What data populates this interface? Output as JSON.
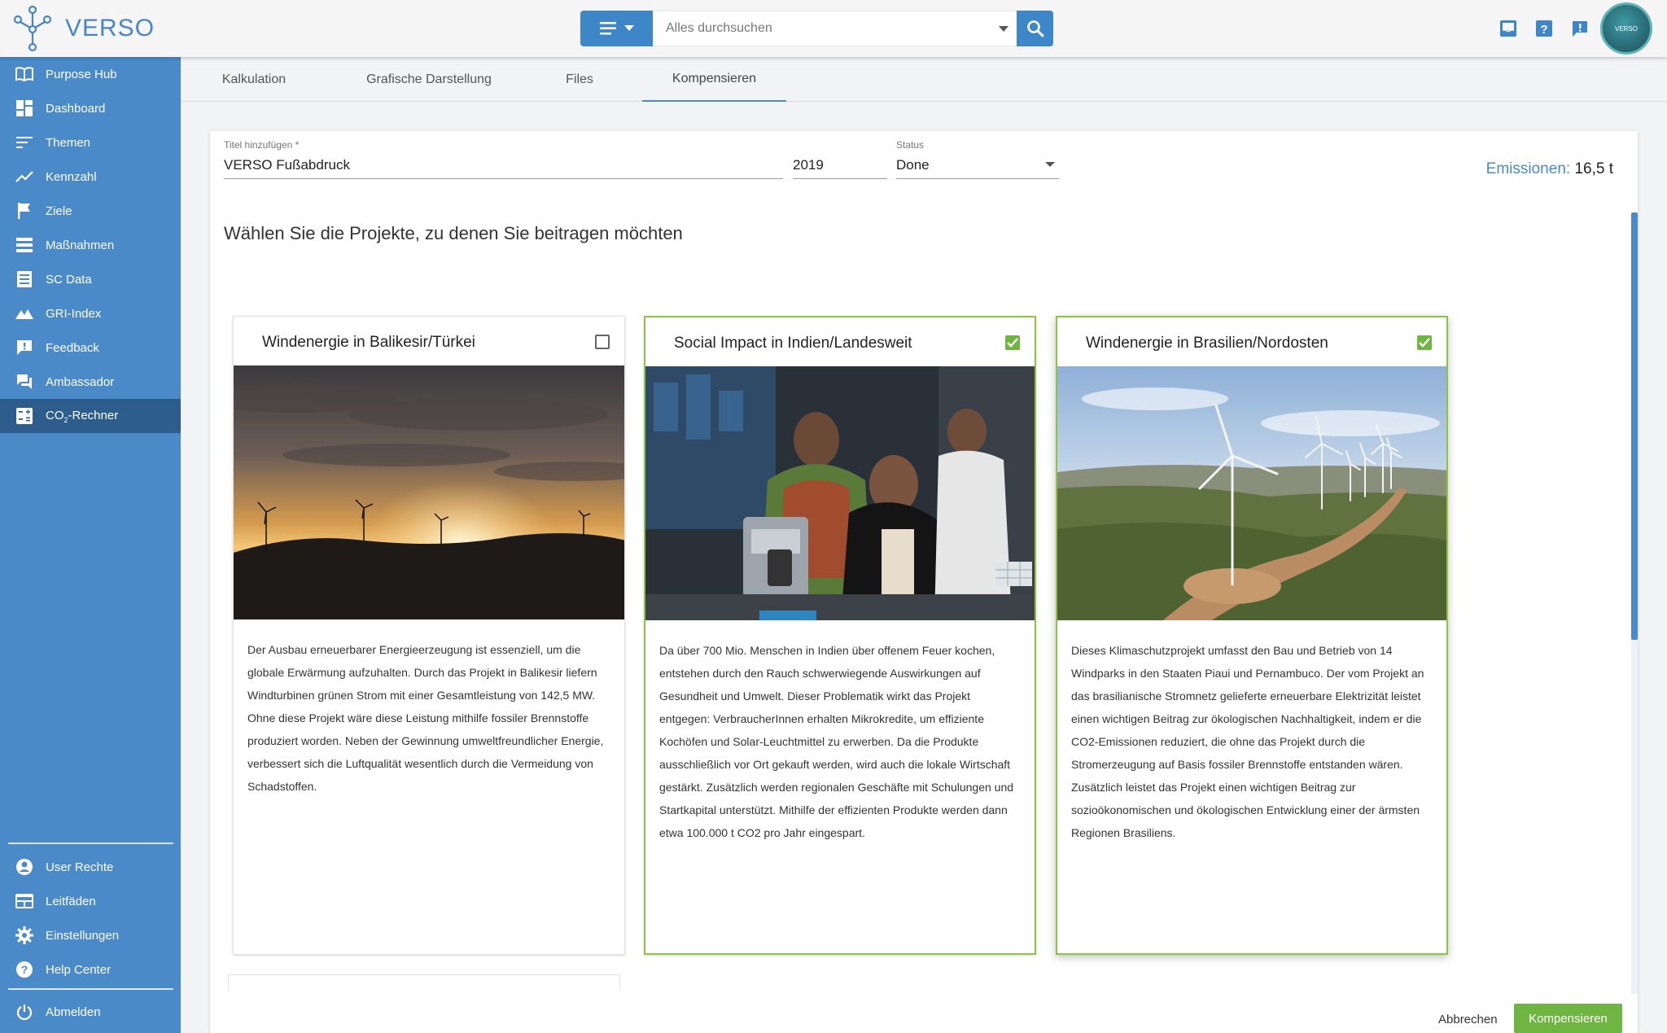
{
  "app": {
    "logo_text": "VERSO",
    "avatar_text": "VERSO"
  },
  "search": {
    "placeholder": "Alles durchsuchen"
  },
  "sidebar": {
    "items": [
      {
        "label": "Purpose Hub",
        "icon": "book-open-icon"
      },
      {
        "label": "Dashboard",
        "icon": "dashboard-icon"
      },
      {
        "label": "Themen",
        "icon": "lines-icon"
      },
      {
        "label": "Kennzahl",
        "icon": "trending-icon"
      },
      {
        "label": "Ziele",
        "icon": "flag-icon"
      },
      {
        "label": "Maßnahmen",
        "icon": "storage-icon"
      },
      {
        "label": "SC Data",
        "icon": "list-icon"
      },
      {
        "label": "GRI-Index",
        "icon": "terrain-icon"
      },
      {
        "label": "Feedback",
        "icon": "feedback-icon"
      },
      {
        "label": "Ambassador",
        "icon": "forum-icon"
      },
      {
        "label_main": "CO",
        "label_sub": "2",
        "label_rest": "-Rechner",
        "icon": "calculator-icon",
        "active": true
      }
    ],
    "bottom_items": [
      {
        "label": "User Rechte",
        "icon": "account-circle-icon"
      },
      {
        "label": "Leitfäden",
        "icon": "web-icon"
      },
      {
        "label": "Einstellungen",
        "icon": "gear-icon"
      },
      {
        "label": "Help Center",
        "icon": "help-circle-icon"
      },
      {
        "label": "Abmelden",
        "icon": "power-icon"
      }
    ]
  },
  "tabs": [
    {
      "label": "Kalkulation"
    },
    {
      "label": "Grafische Darstellung"
    },
    {
      "label": "Files"
    },
    {
      "label": "Kompensieren",
      "active": true
    }
  ],
  "form": {
    "title_label": "Titel hinzufügen *",
    "title_value": "VERSO Fußabdruck",
    "year_value": "2019",
    "status_label": "Status",
    "status_value": "Done"
  },
  "emissions": {
    "label": "Emissionen:",
    "value": "16,5 t"
  },
  "heading": "Wählen Sie die Projekte, zu denen Sie beitragen möchten",
  "projects": [
    {
      "title": "Windenergie in Balikesir/Türkei",
      "checked": false,
      "image": "sunset-wind-turbines",
      "description": "Der Ausbau erneuerbarer Energieerzeugung ist essenziell, um die globale Erwärmung aufzuhalten. Durch das Projekt in Balikesir liefern Windturbinen grünen Strom mit einer Gesamtleistung von 142,5 MW. Ohne diese Projekt wäre diese Leistung mithilfe fossiler Brennstoffe produziert worden. Neben der Gewinnung umweltfreundlicher Energie, verbessert sich die Luftqualität wesentlich durch die Vermeidung von Schadstoffen."
    },
    {
      "title": "Social Impact in Indien/Landesweit",
      "checked": true,
      "image": "women-with-cookstove",
      "description": "Da über 700 Mio. Menschen in Indien über offenem Feuer kochen, entstehen durch den Rauch schwerwiegende Auswirkungen auf Gesundheit und Umwelt. Dieser Problematik wirkt das Projekt entgegen: VerbraucherInnen erhalten Mikrokredite, um effiziente Kochöfen und Solar-Leuchtmittel zu erwerben. Da die Produkte ausschließlich vor Ort gekauft werden, wird auch die lokale Wirtschaft gestärkt. Zusätzlich werden regionalen Geschäfte mit Schulungen und Startkapital unterstützt. Mithilfe der effizienten Produkte werden dann etwa 100.000 t CO2 pro Jahr eingespart."
    },
    {
      "title": "Windenergie in Brasilien/Nordosten",
      "checked": true,
      "image": "aerial-wind-park",
      "description": "Dieses Klimaschutzprojekt umfasst den Bau und Betrieb von 14 Windparks in den Staaten Piaui und Pernambuco. Der vom Projekt an das brasilianische Stromnetz gelieferte erneuerbare Elektrizität leistet einen wichtigen Beitrag zur ökologischen Nachhaltigkeit, indem er die CO2-Emissionen reduziert, die ohne das Projekt durch die Stromerzeugung auf Basis fossiler Brennstoffe entstanden wären. Zusätzlich leistet das Projekt einen wichtigen Beitrag zur sozioökonomischen und ökologischen Entwicklung einer der ärmsten Regionen Brasiliens."
    }
  ],
  "actions": {
    "cancel": "Abbrechen",
    "submit": "Kompensieren"
  },
  "colors": {
    "primary": "#4a8ac9",
    "sidebar_active": "#2d5d8c",
    "success": "#6fb542",
    "selected_border": "#8cc63f"
  }
}
